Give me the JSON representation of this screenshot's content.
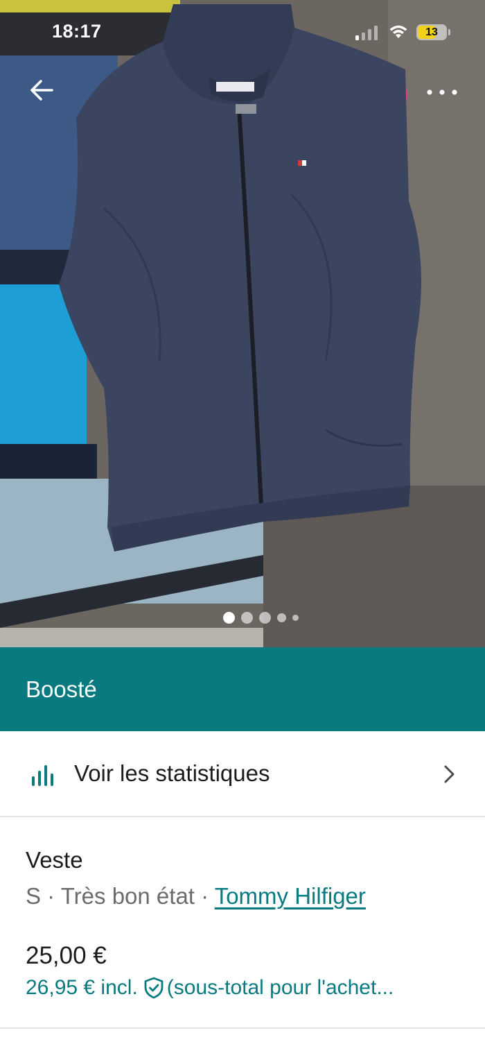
{
  "status_bar": {
    "time": "18:17",
    "battery_level": "13",
    "battery_color": "#f2d11b"
  },
  "header": {
    "back_icon": "arrow-left-icon",
    "more_icon": "more-horizontal-icon"
  },
  "gallery": {
    "photo_count": 5,
    "active_index": 0
  },
  "boost_banner": {
    "label": "Boosté",
    "color": "#087a80"
  },
  "stats_row": {
    "icon": "bar-chart-icon",
    "label": "Voir les statistiques",
    "chevron_icon": "chevron-right-icon"
  },
  "item": {
    "title": "Veste",
    "size": "S",
    "separator": " · ",
    "condition": "Très bon état",
    "brand": "Tommy Hilfiger",
    "price": "25,00 €",
    "price_incl": "26,95 € incl.",
    "protection_icon": "shield-check-icon",
    "protection_text": "(sous-total pour l'achet..."
  }
}
